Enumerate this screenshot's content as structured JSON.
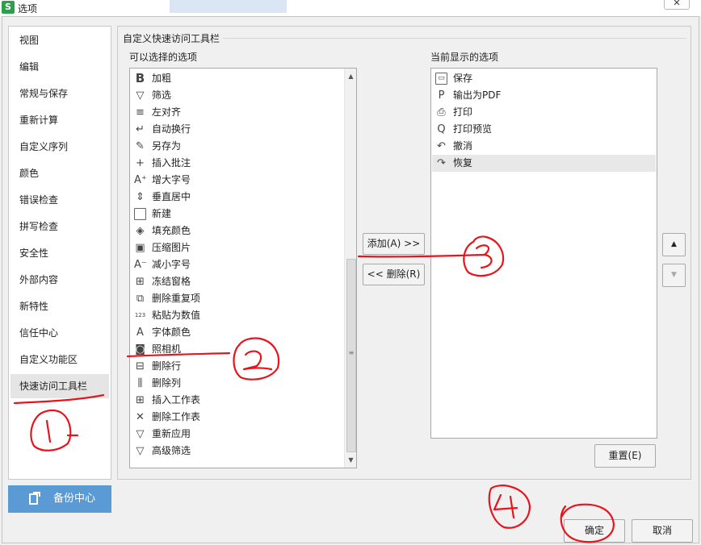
{
  "window": {
    "title": "选项",
    "app_icon": "S",
    "close_glyph": "✕"
  },
  "sidebar": {
    "items": [
      {
        "label": "视图"
      },
      {
        "label": "编辑"
      },
      {
        "label": "常规与保存"
      },
      {
        "label": "重新计算"
      },
      {
        "label": "自定义序列"
      },
      {
        "label": "颜色"
      },
      {
        "label": "错误检查"
      },
      {
        "label": "拼写检查"
      },
      {
        "label": "安全性"
      },
      {
        "label": "外部内容"
      },
      {
        "label": "新特性"
      },
      {
        "label": "信任中心"
      },
      {
        "label": "自定义功能区"
      },
      {
        "label": "快速访问工具栏",
        "active": true
      }
    ],
    "backup_label": "备份中心"
  },
  "main": {
    "section_title": "自定义快速访问工具栏",
    "available_title": "可以选择的选项",
    "current_title": "当前显示的选项",
    "available_items": [
      {
        "label": "加粗",
        "icon": "bold-icon",
        "glyph": "B"
      },
      {
        "label": "筛选",
        "icon": "filter-icon",
        "glyph": "▽"
      },
      {
        "label": "左对齐",
        "icon": "align-left-icon",
        "glyph": "≡"
      },
      {
        "label": "自动换行",
        "icon": "wrap-text-icon",
        "glyph": "↵"
      },
      {
        "label": "另存为",
        "icon": "save-as-icon",
        "glyph": "✎"
      },
      {
        "label": "插入批注",
        "icon": "insert-comment-icon",
        "glyph": "+"
      },
      {
        "label": "增大字号",
        "icon": "increase-font-icon",
        "glyph": "A⁺"
      },
      {
        "label": "垂直居中",
        "icon": "vertical-center-icon",
        "glyph": "⇕"
      },
      {
        "label": "新建",
        "icon": "new-document-icon",
        "glyph": ""
      },
      {
        "label": "填充颜色",
        "icon": "fill-color-icon",
        "glyph": "◈"
      },
      {
        "label": "压缩图片",
        "icon": "compress-image-icon",
        "glyph": "▣"
      },
      {
        "label": "减小字号",
        "icon": "decrease-font-icon",
        "glyph": "A⁻"
      },
      {
        "label": "冻结窗格",
        "icon": "freeze-panes-icon",
        "glyph": "⊞"
      },
      {
        "label": "删除重复项",
        "icon": "remove-duplicates-icon",
        "glyph": "⧉"
      },
      {
        "label": "粘贴为数值",
        "icon": "paste-values-icon",
        "glyph": "123"
      },
      {
        "label": "字体颜色",
        "icon": "font-color-icon",
        "glyph": "A"
      },
      {
        "label": "照相机",
        "icon": "camera-icon",
        "glyph": "◙"
      },
      {
        "label": "删除行",
        "icon": "delete-row-icon",
        "glyph": "⊟"
      },
      {
        "label": "删除列",
        "icon": "delete-column-icon",
        "glyph": "⫼"
      },
      {
        "label": "插入工作表",
        "icon": "insert-sheet-icon",
        "glyph": "⊞"
      },
      {
        "label": "删除工作表",
        "icon": "delete-sheet-icon",
        "glyph": "✕"
      },
      {
        "label": "重新应用",
        "icon": "reapply-filter-icon",
        "glyph": "▽"
      },
      {
        "label": "高级筛选",
        "icon": "advanced-filter-icon",
        "glyph": "▽"
      }
    ],
    "current_items": [
      {
        "label": "保存",
        "icon": "save-icon",
        "glyph": "▭"
      },
      {
        "label": "输出为PDF",
        "icon": "export-pdf-icon",
        "glyph": "P"
      },
      {
        "label": "打印",
        "icon": "print-icon",
        "glyph": "⎙"
      },
      {
        "label": "打印预览",
        "icon": "print-preview-icon",
        "glyph": "Q"
      },
      {
        "label": "撤消",
        "icon": "undo-icon",
        "glyph": "↶"
      },
      {
        "label": "恢复",
        "icon": "redo-icon",
        "glyph": "↷",
        "selected": true
      }
    ],
    "add_label": "添加(A) >>",
    "remove_label": "<< 删除(R)",
    "move_up_glyph": "▲",
    "move_down_glyph": "▼",
    "reset_label": "重置(E)",
    "scroll_up_glyph": "▲",
    "scroll_down_glyph": "▼",
    "scroll_grip_glyph": "≡"
  },
  "footer": {
    "ok_label": "确定",
    "cancel_label": "取消"
  },
  "annotations": {
    "color": "#e8141c",
    "labels": [
      "1",
      "2",
      "3",
      "4"
    ]
  }
}
